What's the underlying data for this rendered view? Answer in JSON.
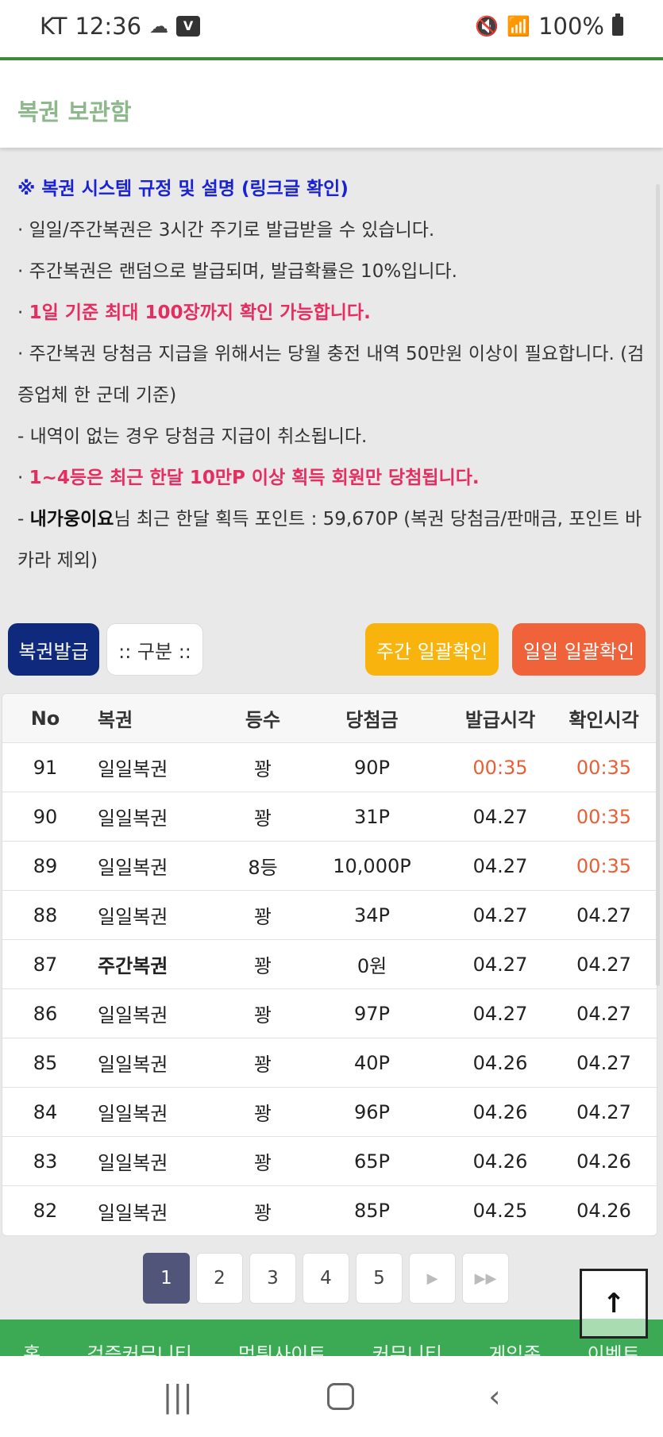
{
  "status_bar": {
    "carrier": "KT",
    "time": "12:36",
    "battery": "100%"
  },
  "header": {
    "title": "복권 보관함"
  },
  "rules": {
    "heading": "※ 복권 시스템 규정 및 설명 (링크글 확인)",
    "line1": "· 일일/주간복권은 3시간 주기로 발급받을 수 있습니다.",
    "line2": "· 주간복권은 랜덤으로 발급되며, 발급확률은 10%입니다.",
    "line3_prefix": "· ",
    "line3": "1일 기준 최대 100장까지 확인 가능합니다.",
    "line4": "· 주간복권 당첨금 지급을 위해서는 당월 충전 내역 50만원 이상이 필요합니다. (검증업체 한 군데 기준)",
    "line5": "  - 내역이 없는 경우 당첨금 지급이 취소됩니다.",
    "line6_prefix": "· ",
    "line6": "1~4등은 최근 한달 10만P 이상 획득 회원만 당첨됩니다.",
    "line7_prefix": "  - ",
    "line7_user": "내가웅이요",
    "line7_rest": "님 최근 한달 획득 포인트 : 59,670P (복권 당첨금/판매금, 포인트 바카라 제외)"
  },
  "buttons": {
    "issue": "복권발급",
    "select": ":: 구분 ::",
    "weekly_check": "주간 일괄확인",
    "daily_check": "일일 일괄확인"
  },
  "table": {
    "headers": {
      "no": "No",
      "name": "복권",
      "rank": "등수",
      "prize": "당첨금",
      "issued": "발급시각",
      "checked": "확인시각"
    },
    "rows": [
      {
        "no": "91",
        "name": "일일복권",
        "rank": "꽝",
        "prize": "90P",
        "issued": "00:35",
        "checked": "00:35"
      },
      {
        "no": "90",
        "name": "일일복권",
        "rank": "꽝",
        "prize": "31P",
        "issued": "04.27",
        "checked": "00:35"
      },
      {
        "no": "89",
        "name": "일일복권",
        "rank": "8등",
        "prize": "10,000P",
        "issued": "04.27",
        "checked": "00:35"
      },
      {
        "no": "88",
        "name": "일일복권",
        "rank": "꽝",
        "prize": "34P",
        "issued": "04.27",
        "checked": "04.27"
      },
      {
        "no": "87",
        "name": "주간복권",
        "rank": "꽝",
        "prize": "0원",
        "issued": "04.27",
        "checked": "04.27"
      },
      {
        "no": "86",
        "name": "일일복권",
        "rank": "꽝",
        "prize": "97P",
        "issued": "04.27",
        "checked": "04.27"
      },
      {
        "no": "85",
        "name": "일일복권",
        "rank": "꽝",
        "prize": "40P",
        "issued": "04.26",
        "checked": "04.27"
      },
      {
        "no": "84",
        "name": "일일복권",
        "rank": "꽝",
        "prize": "96P",
        "issued": "04.26",
        "checked": "04.27"
      },
      {
        "no": "83",
        "name": "일일복권",
        "rank": "꽝",
        "prize": "65P",
        "issued": "04.26",
        "checked": "04.26"
      },
      {
        "no": "82",
        "name": "일일복권",
        "rank": "꽝",
        "prize": "85P",
        "issued": "04.25",
        "checked": "04.26"
      }
    ]
  },
  "pagination": {
    "pages": [
      "1",
      "2",
      "3",
      "4",
      "5"
    ],
    "next": "▶",
    "last": "▶▶"
  },
  "scroll_top": "↑",
  "footer_nav": [
    "홈",
    "검증커뮤니티",
    "먹튀사이트",
    "커뮤니티",
    "게임존",
    "이벤트"
  ],
  "navbar": {
    "recent": "|||",
    "back": "‹"
  }
}
